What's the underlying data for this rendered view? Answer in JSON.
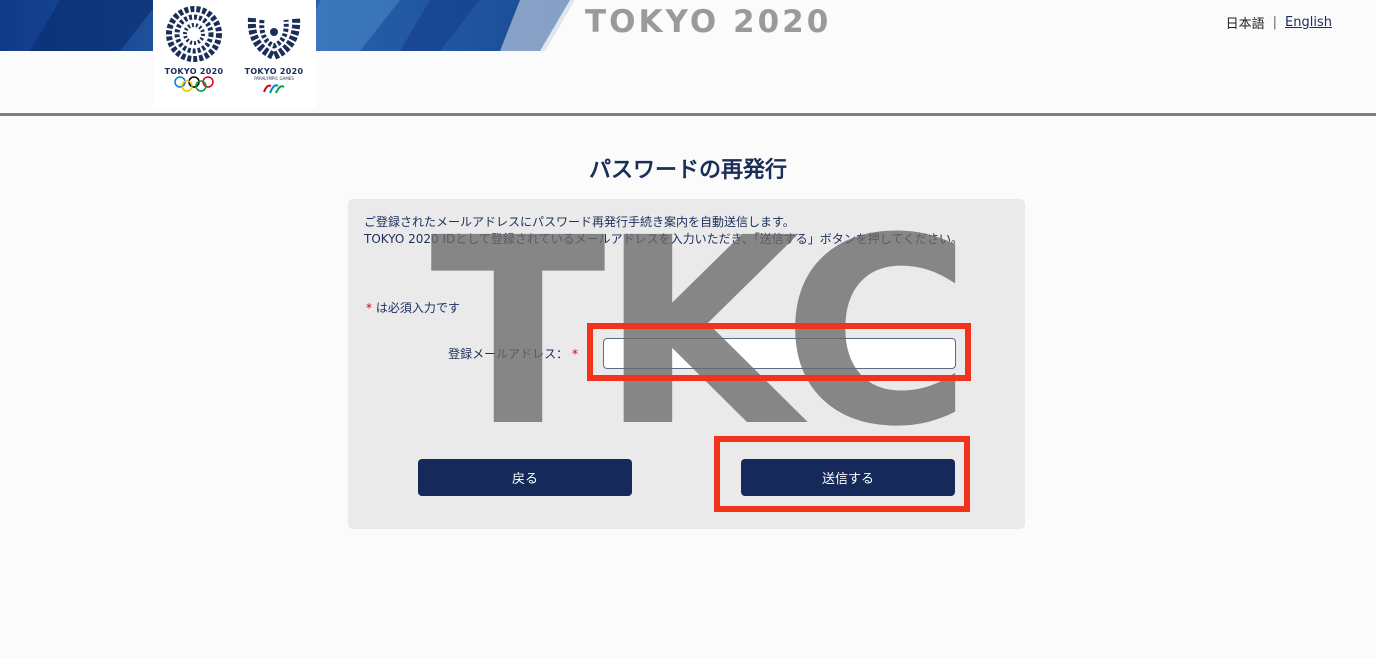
{
  "header": {
    "wordmark": "TOKYO 2020",
    "lang_ja": "日本語",
    "lang_sep": "|",
    "lang_en": "English",
    "logo_olympic_caption": "TOKYO 2020",
    "logo_paralympic_caption": "TOKYO 2020",
    "logo_paralympic_sub": "PARALYMPIC GAMES"
  },
  "page": {
    "title": "パスワードの再発行",
    "intro_line1": "ご登録されたメールアドレスにパスワード再発行手続き案内を自動送信します。",
    "intro_line2": "TOKYO 2020 IDとして登録されているメールアドレスを入力いただき、「送信する」ボタンを押してください。",
    "required_mark": "*",
    "required_note": "は必須入力です",
    "email_label": "登録メールアドレス：",
    "email_value": "",
    "back_button": "戻る",
    "submit_button": "送信する"
  },
  "watermark": "TKC",
  "colors": {
    "navy": "#15295a",
    "text": "#1b2e5a",
    "required": "#d0021b",
    "highlight": "#f3321b",
    "panel": "#eaeaea"
  }
}
